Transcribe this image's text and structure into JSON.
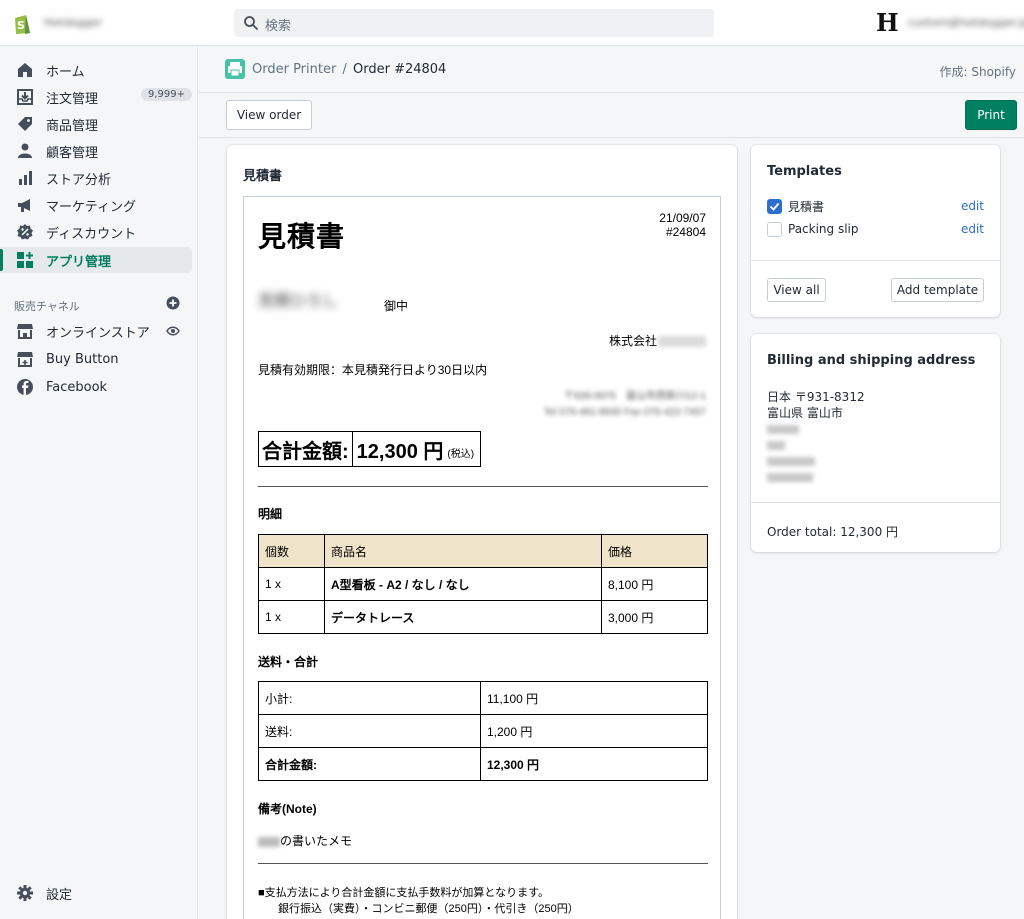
{
  "topbar": {
    "store_name": "Hotdogger",
    "search_placeholder": "検索",
    "account_email": "custom@hotdogger.jp"
  },
  "sidebar": {
    "items": [
      {
        "label": "ホーム"
      },
      {
        "label": "注文管理",
        "badge": "9,999+"
      },
      {
        "label": "商品管理"
      },
      {
        "label": "顧客管理"
      },
      {
        "label": "ストア分析"
      },
      {
        "label": "マーケティング"
      },
      {
        "label": "ディスカウント"
      },
      {
        "label": "アプリ管理"
      }
    ],
    "channels_label": "販売チャネル",
    "channels": [
      {
        "label": "オンラインストア"
      },
      {
        "label": "Buy Button"
      },
      {
        "label": "Facebook"
      }
    ],
    "settings_label": "設定"
  },
  "header": {
    "app_name": "Order Printer",
    "separator": "/",
    "order": "Order #24804",
    "byline": "作成: Shopify"
  },
  "actions": {
    "view_order": "View order",
    "print": "Print"
  },
  "document": {
    "card_title": "見積書",
    "title": "見積書",
    "date": "21/09/07",
    "number": "#24804",
    "customer": "見積ひろし",
    "honorific": "御中",
    "company": "株式会社",
    "validity": "見積有効期限：本見積発行日より30日以内",
    "address_line1": "〒939-0975　富山市西新川12-1",
    "address_line2": "Tel 076-481-8930 Fax 076-422-7457",
    "total_label": "合計金額:",
    "total_value": "12,300 円",
    "total_tax": "(税込)",
    "details_heading": "明細",
    "items_header": [
      "個数",
      "商品名",
      "価格"
    ],
    "items": [
      {
        "qty": "1 x",
        "name": "A型看板 - A2 / なし / なし",
        "price": "8,100 円"
      },
      {
        "qty": "1 x",
        "name": "データトレース",
        "price": "3,000 円"
      }
    ],
    "summary_heading": "送料・合計",
    "summary": [
      {
        "label": "小計:",
        "value": "11,100 円"
      },
      {
        "label": "送料:",
        "value": "1,200 円"
      },
      {
        "label": "合計金額:",
        "value": "12,300 円"
      }
    ],
    "note_heading": "備考(Note)",
    "note_text": "の書いたメモ",
    "footer_line1": "■支払方法により合計金額に支払手数料が加算となります。",
    "footer_line2": "銀行振込（実費）・コンビニ郵便（250円）・代引き（250円）"
  },
  "templates": {
    "title": "Templates",
    "items": [
      {
        "name": "見積書",
        "checked": true,
        "edit": "edit"
      },
      {
        "name": "Packing slip",
        "checked": false,
        "edit": "edit"
      }
    ],
    "view_all": "View all",
    "add_template": "Add template"
  },
  "address": {
    "title": "Billing and shipping address",
    "line1": "日本 〒931-8312",
    "line2": "富山県 富山市",
    "order_total": "Order total: 12,300 円"
  },
  "colors": {
    "primary": "#008060",
    "active_nav": "#007f5f",
    "link": "#2c6ecb",
    "table_header": "#efe4ca"
  }
}
